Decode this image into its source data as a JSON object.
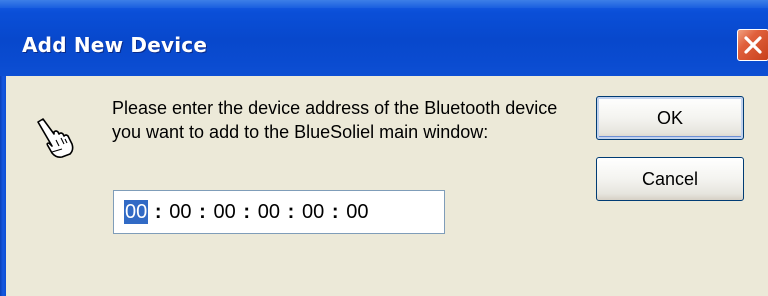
{
  "window": {
    "title": "Add New Device",
    "close_glyph": "✕"
  },
  "dialog": {
    "icon": "pointing-hand-icon",
    "message": "Please enter the device address of the Bluetooth device you want to add to the BlueSoliel main window:",
    "address": {
      "octets": [
        "00",
        "00",
        "00",
        "00",
        "00",
        "00"
      ],
      "separator": ":",
      "selected_octet": 0
    }
  },
  "buttons": {
    "ok_label": "OK",
    "cancel_label": "Cancel"
  },
  "colors": {
    "titlebar": "#0a4bd0",
    "close_button": "#e0603c",
    "face": "#ece9d8",
    "selection": "#316ac5"
  }
}
